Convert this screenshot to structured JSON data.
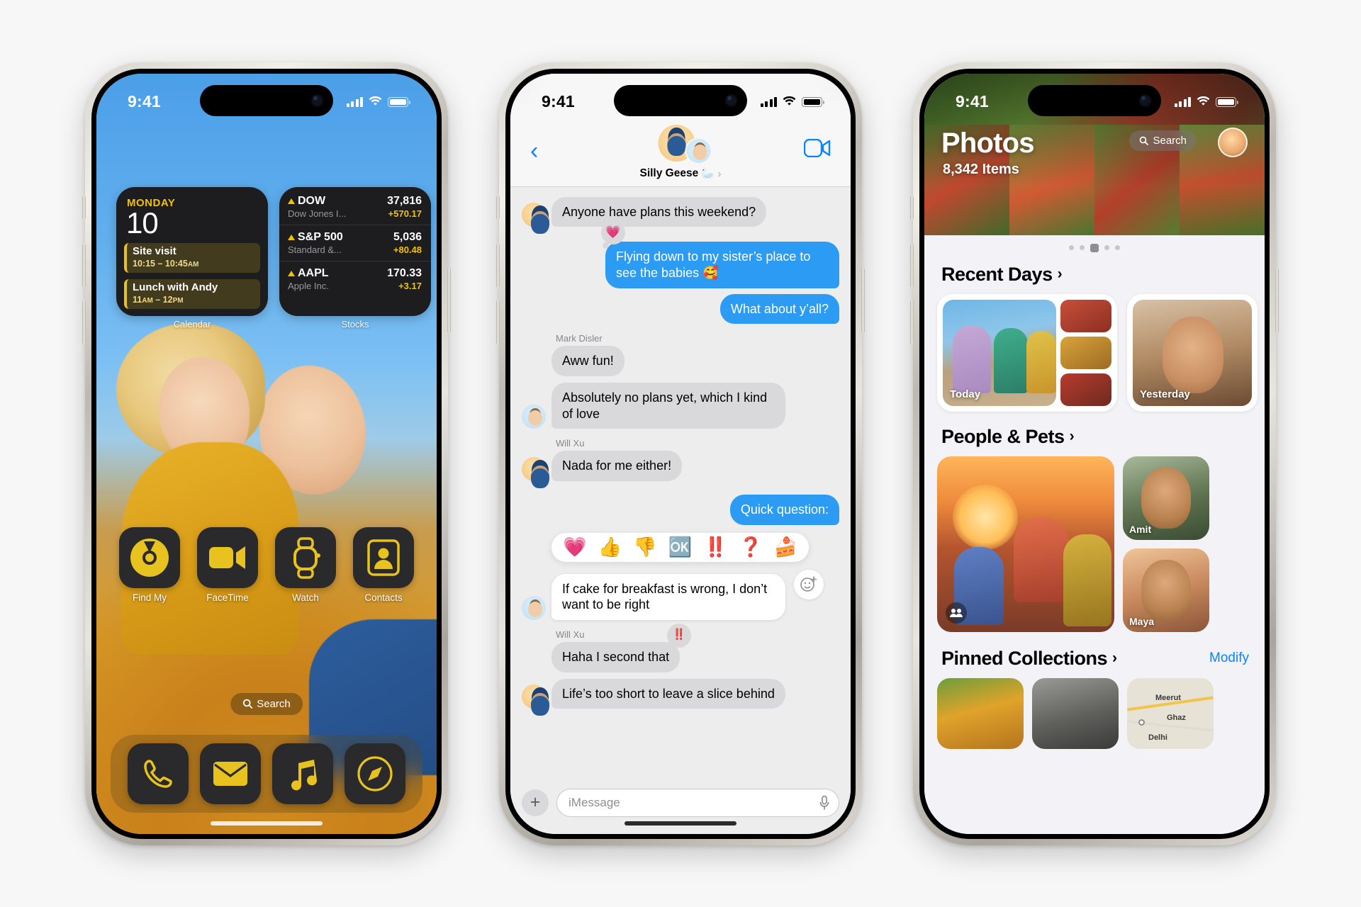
{
  "phones": {
    "home": {
      "status": {
        "time": "9:41",
        "signal_icon": "cellular-signal-icon",
        "wifi_icon": "wifi-icon",
        "battery_icon": "battery-icon"
      },
      "calendar_widget": {
        "label": "Calendar",
        "weekday": "MONDAY",
        "day": "10",
        "events": [
          {
            "title": "Site visit",
            "time": "10:15 – 10:45",
            "meridiem": "AM"
          },
          {
            "title": "Lunch with Andy",
            "time": "11",
            "meridiem": "AM",
            "time2": " – 12",
            "meridiem2": "PM"
          }
        ]
      },
      "stocks_widget": {
        "label": "Stocks",
        "rows": [
          {
            "symbol": "DOW",
            "name": "Dow Jones I...",
            "price": "37,816",
            "change": "+570.17",
            "direction": "up"
          },
          {
            "symbol": "S&P 500",
            "name": "Standard &...",
            "price": "5,036",
            "change": "+80.48",
            "direction": "up"
          },
          {
            "symbol": "AAPL",
            "name": "Apple Inc.",
            "price": "170.33",
            "change": "+3.17",
            "direction": "up"
          }
        ]
      },
      "apps": [
        {
          "name": "Find My",
          "icon": "find-my-icon"
        },
        {
          "name": "FaceTime",
          "icon": "facetime-icon"
        },
        {
          "name": "Watch",
          "icon": "watch-icon"
        },
        {
          "name": "Contacts",
          "icon": "contacts-icon"
        }
      ],
      "search": {
        "label": "Search",
        "icon": "search-icon"
      },
      "dock": [
        {
          "name": "Phone",
          "icon": "phone-icon"
        },
        {
          "name": "Mail",
          "icon": "mail-icon"
        },
        {
          "name": "Music",
          "icon": "music-icon"
        },
        {
          "name": "Safari",
          "icon": "safari-icon"
        }
      ]
    },
    "messages": {
      "status": {
        "time": "9:41"
      },
      "nav": {
        "back_icon": "chevron-left-icon",
        "facetime_icon": "video-camera-icon",
        "group_name": "Silly Geese",
        "group_emoji": "🦢",
        "group_chevron": "›"
      },
      "thread": [
        {
          "type": "incoming",
          "text": "Anyone have plans this weekend?",
          "avatar": "memoji-yellow",
          "sender": ""
        },
        {
          "type": "outgoing",
          "text": "Flying down to my sister’s place to see the babies 🥰",
          "tapback": "💗"
        },
        {
          "type": "outgoing",
          "text": "What about y’all?"
        },
        {
          "type": "incoming",
          "sender": "Mark Disler",
          "text": "Aww fun!",
          "avatar": ""
        },
        {
          "type": "incoming",
          "text": "Absolutely no plans yet, which I kind of love",
          "avatar": "memoji-blue"
        },
        {
          "type": "incoming",
          "sender": "Will Xu",
          "text": "Nada for me either!",
          "avatar": "memoji-yellow"
        },
        {
          "type": "outgoing",
          "text": "Quick question:"
        }
      ],
      "tapback_bar": {
        "emojis": [
          "💗",
          "👍",
          "👎",
          "🆗",
          "‼️",
          "❓",
          "🍰"
        ],
        "plus_icon": "add-reaction-icon"
      },
      "thread_2": [
        {
          "type": "incoming",
          "text": "If cake for breakfast is wrong, I don’t want to be right",
          "avatar": "memoji-blue"
        },
        {
          "type": "incoming",
          "sender": "Will Xu",
          "text": "Haha I second that",
          "avatar": "",
          "tapback": "‼️"
        },
        {
          "type": "incoming",
          "text": "Life’s too short to leave a slice behind",
          "avatar": "memoji-yellow"
        }
      ],
      "input": {
        "plus_icon": "plus-icon",
        "placeholder": "iMessage",
        "mic_icon": "microphone-icon"
      }
    },
    "photos": {
      "status": {
        "time": "9:41"
      },
      "header": {
        "title": "Photos",
        "count": "8,342 Items",
        "search_label": "Search",
        "search_icon": "search-icon",
        "avatar": "profile-avatar"
      },
      "sections": [
        {
          "title": "Recent Days",
          "chevron": "›",
          "action": ""
        },
        {
          "title": "People & Pets",
          "chevron": "›",
          "action": ""
        },
        {
          "title": "Pinned Collections",
          "chevron": "›",
          "action": "Modify"
        }
      ],
      "recent_days": [
        {
          "caption": "Today"
        },
        {
          "caption": "Yesterday"
        }
      ],
      "people_pets": [
        {
          "caption": "",
          "badge_icon": "group-people-icon"
        },
        {
          "caption": "Amit"
        },
        {
          "caption": "Maya"
        }
      ],
      "pinned_collections": [
        {
          "caption": ""
        },
        {
          "caption": ""
        },
        {
          "caption": "Map",
          "labels": [
            "Meerut",
            "Ghaz",
            "Delhi"
          ]
        }
      ]
    }
  },
  "colors": {
    "accent_blue": "#0a84ff",
    "bubble_blue": "#2b9bf4",
    "bubble_gray": "#d9d9db",
    "widget_dark": "#1d1d1f",
    "stocks_yellow": "#f2c200",
    "page_bg": "#f7f7f7"
  }
}
